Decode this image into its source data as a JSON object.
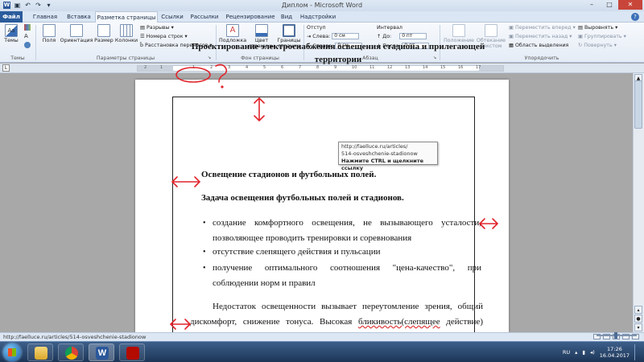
{
  "window": {
    "title": "Диплом - Microsoft Word",
    "controls": [
      "–",
      "□",
      "✕"
    ]
  },
  "tabs": [
    {
      "label": "Файл"
    },
    {
      "label": "Главная"
    },
    {
      "label": "Вставка"
    },
    {
      "label": "Разметка страницы"
    },
    {
      "label": "Ссылки"
    },
    {
      "label": "Рассылки"
    },
    {
      "label": "Рецензирование"
    },
    {
      "label": "Вид"
    },
    {
      "label": "Надстройки"
    }
  ],
  "ribbon": {
    "themes": {
      "big": "Темы",
      "group": "Темы"
    },
    "page_setup": {
      "fields": "Поля",
      "orientation": "Ориентация",
      "size": "Размер",
      "columns": "Колонки",
      "breaks": "Разрывы",
      "line_numbers": "Номера строк",
      "hyphenation": "Расстановка переносов",
      "group": "Параметры страницы"
    },
    "background": {
      "watermark": "Подложка",
      "page_color_1": "Цвет",
      "page_color_2": "страницы",
      "page_borders_1": "Границы",
      "page_borders_2": "страниц",
      "group": "Фон страницы"
    },
    "paragraph": {
      "indent_title": "Отступ",
      "left_label": "Слева:",
      "left_value": "0 см",
      "right_label": "Справа:",
      "right_value": "0 см",
      "spacing_title": "Интервал",
      "before_label": "До:",
      "before_value": "0 пт",
      "after_label": "После:",
      "after_value": "0 пт",
      "group": "Абзац"
    },
    "arrange": {
      "position_1": "Положение",
      "wrap_1": "Обтекание",
      "wrap_2": "текстом",
      "bring_forward": "Переместить вперед",
      "send_backward": "Переместить назад",
      "selection_pane": "Область выделения",
      "align": "Выровнять",
      "group_btn": "Группировать",
      "rotate": "Повернуть",
      "group": "Упорядочить"
    }
  },
  "ruler": {
    "numbers": [
      "2",
      "1",
      "1",
      "2",
      "3",
      "4",
      "5",
      "6",
      "7",
      "8",
      "9",
      "10",
      "11",
      "12",
      "13",
      "14",
      "15",
      "16",
      "17"
    ],
    "corner": "L"
  },
  "document": {
    "title": "Проектирование электроснабжения освещения стадиона и прилегающей территории",
    "heading1": "Освещение стадионов и футбольных полей.",
    "heading2": "Задача освещения футбольных полей и стадионов.",
    "bullet1_words": [
      "создание",
      "комфортного",
      "освещения,",
      "не",
      "вызывающего",
      "усталости,"
    ],
    "bullet1_line2": "позволяющее проводить тренировки и соревнования",
    "bullet2": "отсутствие слепящего действия и пульсации",
    "bullet3_words": [
      "получение",
      "оптимального",
      "соотношения",
      "\"цена-качество\",",
      "при"
    ],
    "bullet3_line2": "соблюдении норм и правил",
    "para_line1_words": [
      "Недостаток",
      "освещенности",
      "вызывает",
      "переутомление",
      "зрения,",
      "общий"
    ],
    "para_line2_words": [
      "дискомфорт,",
      "снижение",
      "тонуса.",
      "Высокая",
      "бликивость(слепящее",
      "действие)"
    ]
  },
  "tooltip": {
    "line1": "http://faelluce.ru/articles/",
    "line2": "514-osveshchenie-stadionow",
    "line3": "Нажмите CTRL и щелкните ссылку"
  },
  "status": {
    "url": "http://faelluce.ru/articles/514-osveshchenie-stadionow"
  },
  "taskbar": {
    "lang": "RU",
    "time": "17:26",
    "date": "16.04.2017"
  },
  "annotation": {
    "question_mark": "?",
    "color": "#e0242b"
  }
}
